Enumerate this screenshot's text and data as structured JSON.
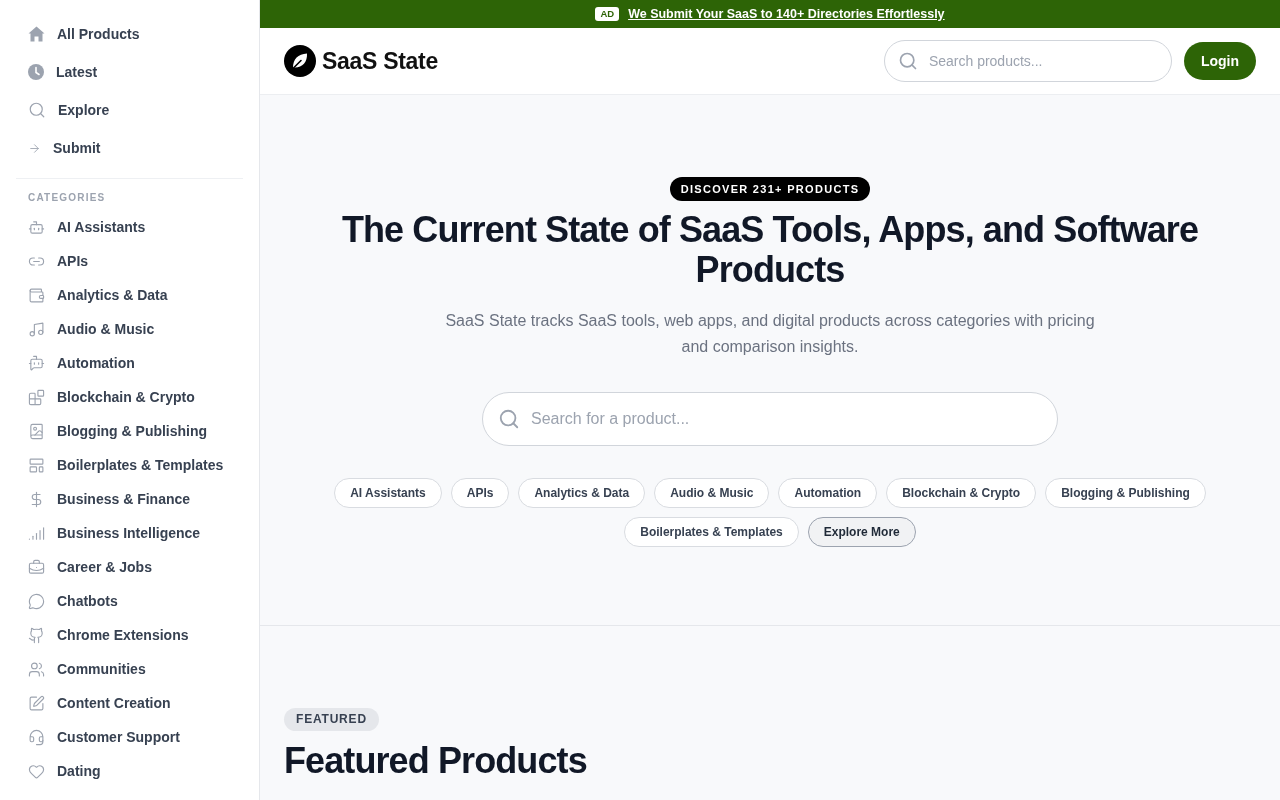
{
  "ad_banner": {
    "badge": "AD",
    "link": "We Submit Your SaaS to 140+ Directories Effortlessly"
  },
  "sidebar": {
    "nav_items": [
      {
        "label": "All Products"
      },
      {
        "label": "Latest"
      },
      {
        "label": "Explore"
      },
      {
        "label": "Submit"
      }
    ],
    "categories_heading": "CATEGORIES",
    "categories": [
      {
        "label": "AI Assistants"
      },
      {
        "label": "APIs"
      },
      {
        "label": "Analytics & Data"
      },
      {
        "label": "Audio & Music"
      },
      {
        "label": "Automation"
      },
      {
        "label": "Blockchain & Crypto"
      },
      {
        "label": "Blogging & Publishing"
      },
      {
        "label": "Boilerplates & Templates"
      },
      {
        "label": "Business & Finance"
      },
      {
        "label": "Business Intelligence"
      },
      {
        "label": "Career & Jobs"
      },
      {
        "label": "Chatbots"
      },
      {
        "label": "Chrome Extensions"
      },
      {
        "label": "Communities"
      },
      {
        "label": "Content Creation"
      },
      {
        "label": "Customer Support"
      },
      {
        "label": "Dating"
      }
    ]
  },
  "header": {
    "logo_text": "SaaS State",
    "search": {
      "placeholder": "Search products..."
    },
    "login_button": "Login"
  },
  "hero": {
    "badge": "DISCOVER 231+ PRODUCTS",
    "title": "The Current State of SaaS Tools, Apps, and Software Products",
    "subtitle": "SaaS State tracks SaaS tools, web apps, and digital products across categories with pricing and comparison insights.",
    "search": {
      "placeholder": "Search for a product..."
    },
    "category_chips": [
      "AI Assistants",
      "APIs",
      "Analytics & Data",
      "Audio & Music",
      "Automation",
      "Blockchain & Crypto",
      "Blogging & Publishing",
      "Boilerplates & Templates"
    ],
    "more_button": "Explore More"
  },
  "featured": {
    "badge": "FEATURED",
    "title": "Featured Products"
  }
}
